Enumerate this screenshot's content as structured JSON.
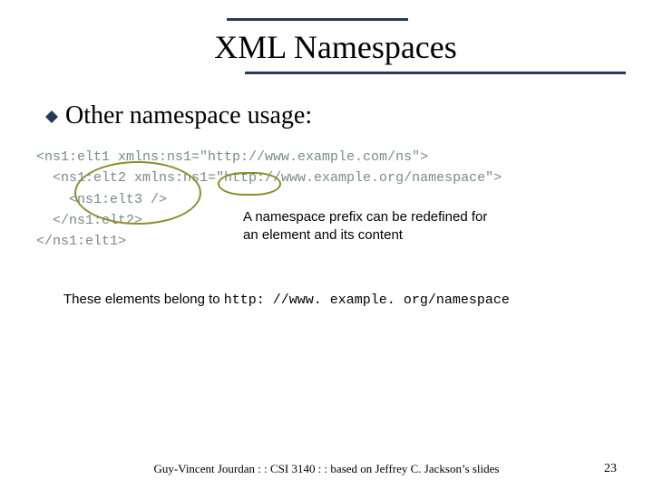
{
  "title": "XML Namespaces",
  "bullet": "Other namespace usage:",
  "code": "<ns1:elt1 xmlns:ns1=\"http://www.example.com/ns\">\n  <ns1:elt2 xmlns:ns1=\"http://www.example.org/namespace\">\n    <ns1:elt3 />\n  </ns1:elt2>\n</ns1:elt1>",
  "callout_line1": "A namespace prefix can be redefined for",
  "callout_line2": "an element and its content",
  "belong_prefix": "These elements belong to ",
  "belong_uri": "http: //www. example. org/namespace",
  "footer": "Guy-Vincent Jourdan : : CSI 3140 : : based on Jeffrey C. Jackson’s slides",
  "page": "23"
}
